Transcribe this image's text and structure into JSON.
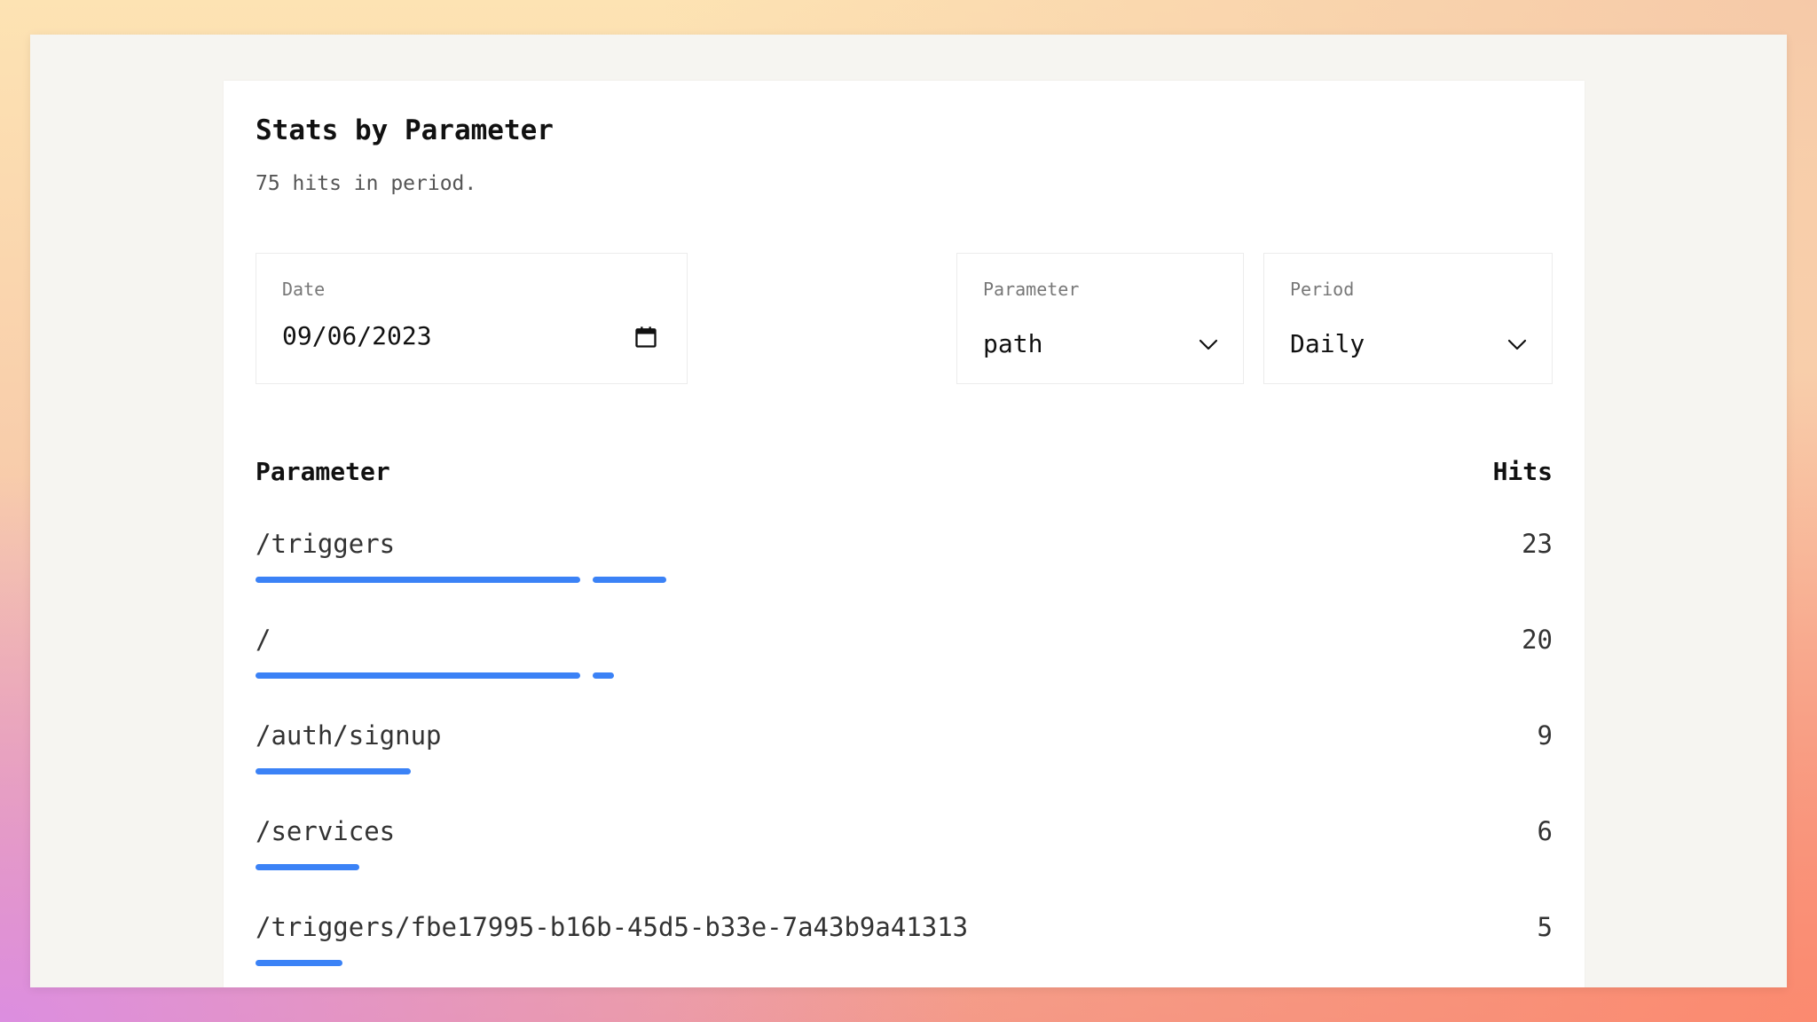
{
  "page": {
    "title": "Stats by Parameter",
    "summary": "75 hits in period."
  },
  "filters": {
    "date": {
      "label": "Date",
      "value": "09/06/2023"
    },
    "parameter": {
      "label": "Parameter",
      "value": "path"
    },
    "period": {
      "label": "Period",
      "value": "Daily"
    }
  },
  "table": {
    "headers": {
      "parameter": "Parameter",
      "hits": "Hits"
    },
    "rows": [
      {
        "parameter": "/triggers",
        "hits": "23",
        "bar_fraction": 0.307
      },
      {
        "parameter": "/",
        "hits": "20",
        "bar_fraction": 0.267
      },
      {
        "parameter": "/auth/signup",
        "hits": "9",
        "bar_fraction": 0.12
      },
      {
        "parameter": "/services",
        "hits": "6",
        "bar_fraction": 0.08
      },
      {
        "parameter": "/triggers/fbe17995-b16b-45d5-b33e-7a43b9a41313",
        "hits": "5",
        "bar_fraction": 0.067
      }
    ]
  },
  "colors": {
    "bar": "#3b82f6",
    "page_bg": "#f6f5f1",
    "card_bg": "#ffffff"
  },
  "icons": {
    "date": "calendar-icon",
    "select": "chevron-down-icon"
  }
}
